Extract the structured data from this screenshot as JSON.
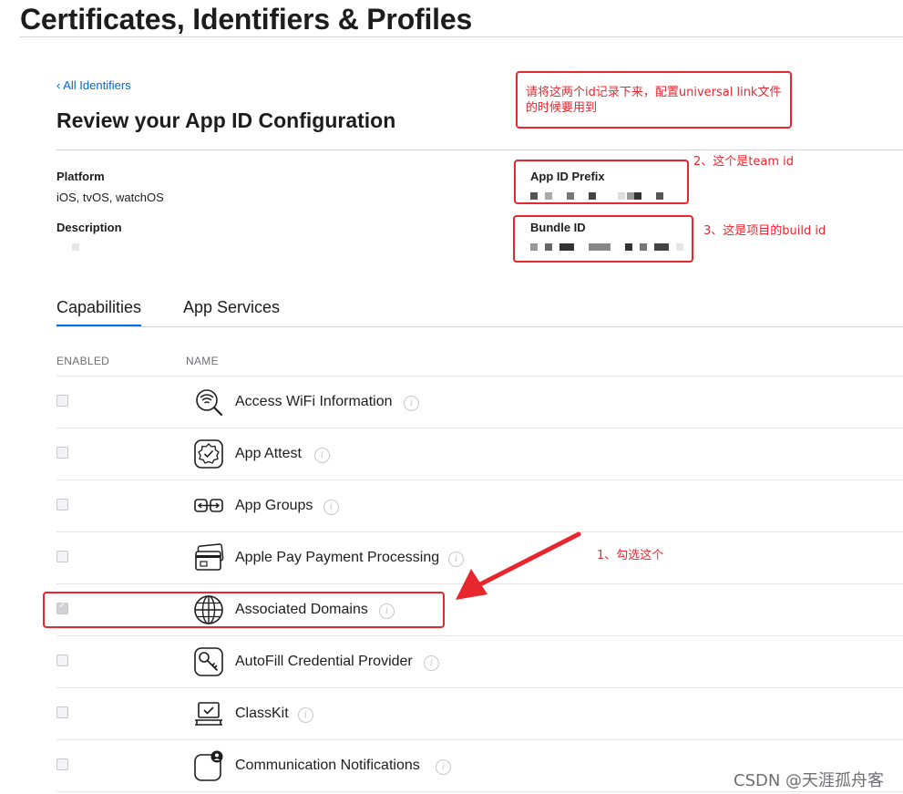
{
  "header": {
    "title": "Certificates, Identifiers & Profiles"
  },
  "nav": {
    "back_link": "‹ All Identifiers"
  },
  "review": {
    "title": "Review your App ID Configuration",
    "platform_label": "Platform",
    "platform_value": "iOS, tvOS, watchOS",
    "description_label": "Description",
    "app_id_prefix_label": "App ID Prefix",
    "bundle_id_label": "Bundle ID"
  },
  "tabs": [
    {
      "label": "Capabilities",
      "active": true
    },
    {
      "label": "App Services",
      "active": false
    }
  ],
  "table": {
    "col_enabled": "ENABLED",
    "col_name": "NAME",
    "rows": [
      {
        "name": "Access WiFi Information",
        "icon": "wifi-search-icon",
        "checked": false
      },
      {
        "name": "App Attest",
        "icon": "badge-check-icon",
        "checked": false
      },
      {
        "name": "App Groups",
        "icon": "app-groups-icon",
        "checked": false
      },
      {
        "name": "Apple Pay Payment Processing",
        "icon": "credit-card-icon",
        "checked": false
      },
      {
        "name": "Associated Domains",
        "icon": "globe-icon",
        "checked": true
      },
      {
        "name": "AutoFill Credential Provider",
        "icon": "key-icon",
        "checked": false
      },
      {
        "name": "ClassKit",
        "icon": "classkit-icon",
        "checked": false
      },
      {
        "name": "Communication Notifications",
        "icon": "notification-person-icon",
        "checked": false
      }
    ]
  },
  "annotations": {
    "note_top": "请将这两个id记录下来，配置universal link文件的时候要用到",
    "note_team": "2、这个是team id",
    "note_bundle": "3、这是项目的build id",
    "note_check": "1、勾选这个",
    "color": "#e8262e"
  },
  "watermark": "CSDN @天涯孤舟客",
  "colors": {
    "link": "#0066cc",
    "tab_accent": "#0071e3",
    "text": "#1d1d1f"
  }
}
